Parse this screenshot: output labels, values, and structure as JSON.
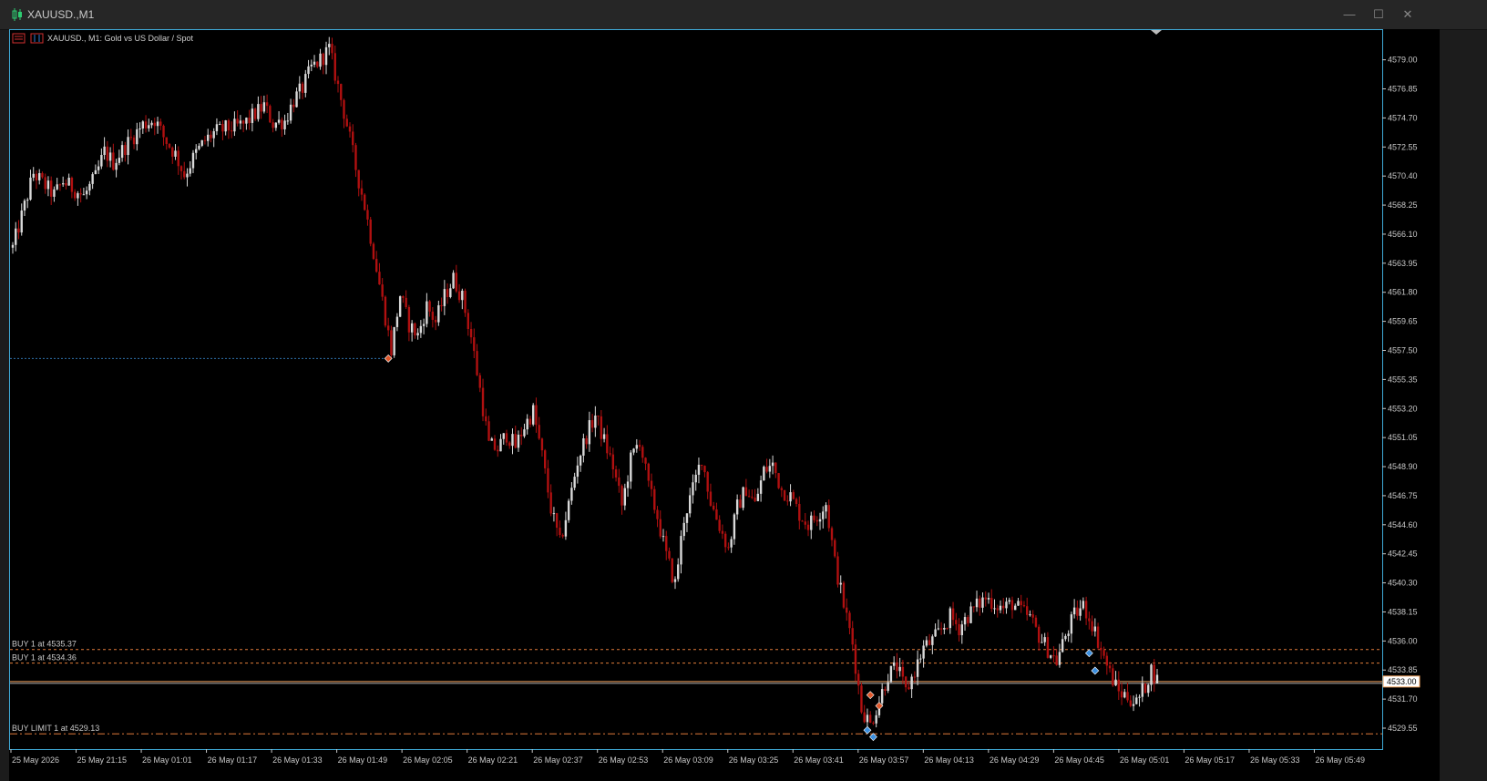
{
  "window": {
    "title": "XAUUSD.,M1",
    "minimize_glyph": "—",
    "maximize_glyph": "☐",
    "close_glyph": "✕"
  },
  "chart_header": {
    "text": "XAUUSD., M1:  Gold vs US Dollar / Spot"
  },
  "colors": {
    "bull": "#d9d9d9",
    "bear": "#b01010",
    "order_line": "#e07b3a",
    "price_line": "#f4a460",
    "grid_text": "#c8c8c8",
    "axis_frame": "#3fa9d6"
  },
  "order_lines": [
    {
      "label": "BUY 1 at 4535.37",
      "price": 4535.37,
      "style": "dashed"
    },
    {
      "label": "BUY 1 at 4534.36",
      "price": 4534.36,
      "style": "dashed"
    },
    {
      "label": "BUY LIMIT 1 at 4529.13",
      "price": 4529.13,
      "style": "dashdot"
    }
  ],
  "current_price": {
    "label": "4533.00",
    "price": 4533.0
  },
  "entry_line": {
    "price": 4556.9
  },
  "chart_data": {
    "type": "candlestick",
    "symbol": "XAUUSD.",
    "timeframe": "M1",
    "ylim": [
      4528.0,
      4581.2
    ],
    "y_ticks": [
      "4579.00",
      "4576.85",
      "4574.70",
      "4572.55",
      "4570.40",
      "4568.25",
      "4566.10",
      "4563.95",
      "4561.80",
      "4559.65",
      "4557.50",
      "4555.35",
      "4553.20",
      "4551.05",
      "4548.90",
      "4546.75",
      "4544.60",
      "4542.45",
      "4540.30",
      "4538.15",
      "4536.00",
      "4533.85",
      "4531.70",
      "4529.55"
    ],
    "x_ticks": [
      "25 May 2026",
      "25 May 21:15",
      "26 May 01:01",
      "26 May 01:17",
      "26 May 01:33",
      "26 May 01:49",
      "26 May 02:05",
      "26 May 02:21",
      "26 May 02:37",
      "26 May 02:53",
      "26 May 03:09",
      "26 May 03:25",
      "26 May 03:41",
      "26 May 03:57",
      "26 May 04:13",
      "26 May 04:29",
      "26 May 04:45",
      "26 May 05:01",
      "26 May 05:17",
      "26 May 05:33",
      "26 May 05:49"
    ],
    "close_path": [
      [
        0,
        4565.1
      ],
      [
        4,
        4568.2
      ],
      [
        7,
        4570.6
      ],
      [
        10,
        4569.9
      ],
      [
        14,
        4569.0
      ],
      [
        17,
        4570.0
      ],
      [
        21,
        4569.4
      ],
      [
        24,
        4568.9
      ],
      [
        28,
        4570.3
      ],
      [
        31,
        4572.2
      ],
      [
        34,
        4571.4
      ],
      [
        38,
        4572.6
      ],
      [
        41,
        4573.4
      ],
      [
        44,
        4574.2
      ],
      [
        48,
        4574.6
      ],
      [
        51,
        4573.3
      ],
      [
        55,
        4572.0
      ],
      [
        58,
        4570.5
      ],
      [
        62,
        4572.1
      ],
      [
        65,
        4573.0
      ],
      [
        68,
        4573.6
      ],
      [
        72,
        4573.9
      ],
      [
        75,
        4574.0
      ],
      [
        78,
        4574.2
      ],
      [
        82,
        4575.0
      ],
      [
        85,
        4575.6
      ],
      [
        88,
        4574.3
      ],
      [
        92,
        4574.5
      ],
      [
        95,
        4576.0
      ],
      [
        98,
        4576.9
      ],
      [
        101,
        4578.4
      ],
      [
        104,
        4579.0
      ],
      [
        107,
        4579.8
      ],
      [
        110,
        4577.0
      ],
      [
        113,
        4574.2
      ],
      [
        116,
        4571.0
      ],
      [
        119,
        4568.2
      ],
      [
        122,
        4564.8
      ],
      [
        125,
        4561.2
      ],
      [
        128,
        4557.5
      ],
      [
        131,
        4561.6
      ],
      [
        134,
        4559.4
      ],
      [
        137,
        4558.6
      ],
      [
        140,
        4560.8
      ],
      [
        143,
        4559.6
      ],
      [
        146,
        4561.5
      ],
      [
        149,
        4562.8
      ],
      [
        152,
        4561.4
      ],
      [
        155,
        4558.5
      ],
      [
        158,
        4554.6
      ],
      [
        161,
        4550.5
      ],
      [
        164,
        4550.2
      ],
      [
        167,
        4551.3
      ],
      [
        170,
        4550.4
      ],
      [
        173,
        4551.9
      ],
      [
        176,
        4553.0
      ],
      [
        179,
        4549.7
      ],
      [
        182,
        4545.8
      ],
      [
        185,
        4543.2
      ],
      [
        188,
        4546.1
      ],
      [
        191,
        4549.3
      ],
      [
        194,
        4551.2
      ],
      [
        197,
        4552.7
      ],
      [
        200,
        4550.8
      ],
      [
        203,
        4548.9
      ],
      [
        206,
        4546.0
      ],
      [
        209,
        4549.4
      ],
      [
        212,
        4550.9
      ],
      [
        215,
        4547.4
      ],
      [
        218,
        4545.2
      ],
      [
        221,
        4542.3
      ],
      [
        224,
        4540.2
      ],
      [
        227,
        4545.1
      ],
      [
        230,
        4547.2
      ],
      [
        233,
        4549.6
      ],
      [
        236,
        4546.3
      ],
      [
        239,
        4544.5
      ],
      [
        242,
        4542.8
      ],
      [
        245,
        4545.9
      ],
      [
        248,
        4547.3
      ],
      [
        251,
        4546.1
      ],
      [
        254,
        4548.6
      ],
      [
        257,
        4549.0
      ],
      [
        260,
        4547.2
      ],
      [
        263,
        4546.7
      ],
      [
        266,
        4545.4
      ],
      [
        269,
        4544.6
      ],
      [
        272,
        4545.3
      ],
      [
        275,
        4546.2
      ],
      [
        278,
        4541.8
      ],
      [
        281,
        4538.7
      ],
      [
        284,
        4535.8
      ],
      [
        287,
        4531.0
      ],
      [
        290,
        4529.8
      ],
      [
        293,
        4531.6
      ],
      [
        296,
        4533.5
      ],
      [
        299,
        4534.1
      ],
      [
        302,
        4532.2
      ],
      [
        305,
        4533.8
      ],
      [
        308,
        4535.5
      ],
      [
        311,
        4536.0
      ],
      [
        314,
        4536.8
      ],
      [
        317,
        4537.8
      ],
      [
        320,
        4537.0
      ],
      [
        323,
        4537.9
      ],
      [
        326,
        4538.6
      ],
      [
        329,
        4539.2
      ],
      [
        332,
        4538.8
      ],
      [
        335,
        4538.4
      ],
      [
        338,
        4538.8
      ],
      [
        341,
        4538.2
      ],
      [
        344,
        4537.7
      ],
      [
        347,
        4536.4
      ],
      [
        350,
        4535.4
      ],
      [
        353,
        4534.5
      ],
      [
        356,
        4536.4
      ],
      [
        359,
        4537.9
      ],
      [
        362,
        4538.6
      ],
      [
        365,
        4537.3
      ],
      [
        368,
        4535.4
      ],
      [
        371,
        4533.6
      ],
      [
        374,
        4532.2
      ],
      [
        377,
        4531.9
      ],
      [
        380,
        4531.4
      ],
      [
        383,
        4532.7
      ],
      [
        385,
        4533.9
      ],
      [
        387,
        4533.1
      ]
    ],
    "bar_count": 388,
    "trade_markers": [
      {
        "bar": 127,
        "price": 4556.9,
        "kind": "sell"
      },
      {
        "bar": 290,
        "price": 4532.0,
        "kind": "sell"
      },
      {
        "bar": 293,
        "price": 4531.2,
        "kind": "sell"
      },
      {
        "bar": 289,
        "price": 4529.4,
        "kind": "buy"
      },
      {
        "bar": 291,
        "price": 4528.9,
        "kind": "buy"
      },
      {
        "bar": 364,
        "price": 4535.1,
        "kind": "buy"
      },
      {
        "bar": 366,
        "price": 4533.8,
        "kind": "buy"
      }
    ]
  }
}
